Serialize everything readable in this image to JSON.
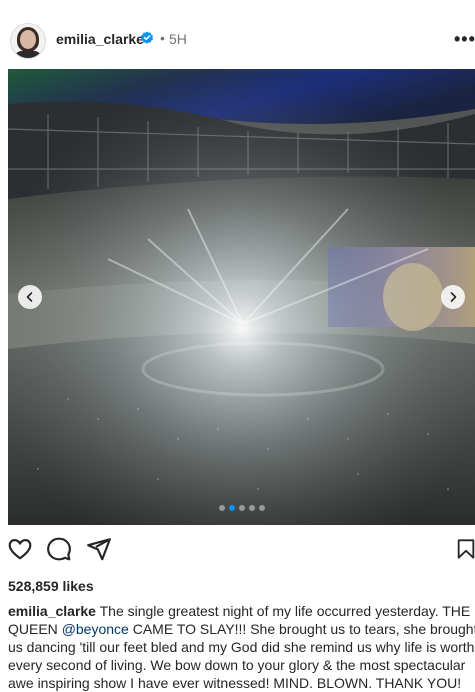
{
  "post": {
    "username": "emilia_clarke",
    "separator": "•",
    "time": "5H",
    "more": "•••",
    "likes": "528,859 likes",
    "carousel": {
      "count": 5,
      "active_index": 1
    },
    "caption": {
      "username": "emilia_clarke",
      "text_before_mention": " The single greatest night of my life occurred yesterday. THE QUEEN ",
      "mention": "@beyonce",
      "text_after_mention": " CAME TO SLAY!!! She brought us to tears, she brought us dancing 'till our feet bled and my God did she remind us why life is worth every second of living. We bow down to your glory & the most spectacular awe inspiring show I have ever witnessed! MIND. BLOWN. THANK YOU!"
    }
  },
  "icons": {
    "verified": "verified-badge-icon",
    "prev": "chevron-left-icon",
    "next": "chevron-right-icon",
    "like": "heart-icon",
    "comment": "comment-icon",
    "share": "share-icon",
    "save": "bookmark-icon"
  },
  "colors": {
    "verified": "#0095f6",
    "mention": "#00376b",
    "active_dot": "#0095f6"
  }
}
